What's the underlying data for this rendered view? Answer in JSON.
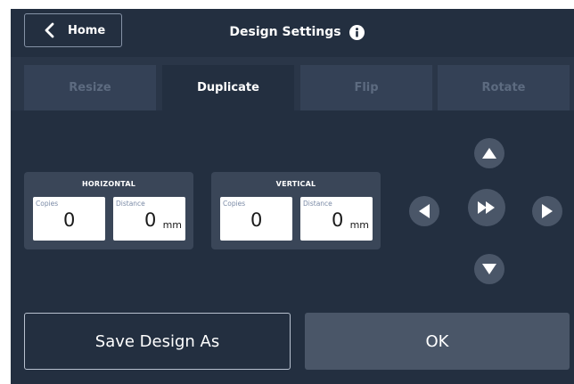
{
  "header": {
    "home_label": "Home",
    "title": "Design Settings",
    "back_icon": "chevron-left-icon",
    "info_icon": "info-icon"
  },
  "tabs": [
    {
      "label": "Resize",
      "active": false
    },
    {
      "label": "Duplicate",
      "active": true
    },
    {
      "label": "Flip",
      "active": false
    },
    {
      "label": "Rotate",
      "active": false
    }
  ],
  "horizontal": {
    "title": "HORIZONTAL",
    "copies_label": "Copies",
    "copies_value": "0",
    "distance_label": "Distance",
    "distance_value": "0",
    "distance_unit": "mm"
  },
  "vertical": {
    "title": "VERTICAL",
    "copies_label": "Copies",
    "copies_value": "0",
    "distance_label": "Distance",
    "distance_value": "0",
    "distance_unit": "mm"
  },
  "arrows": {
    "up_icon": "triangle-up-icon",
    "down_icon": "triangle-down-icon",
    "left_icon": "triangle-left-icon",
    "right_icon": "triangle-right-icon",
    "center_icon": "fast-forward-icon"
  },
  "footer": {
    "save_label": "Save Design As",
    "ok_label": "OK"
  },
  "colors": {
    "background": "#232f40",
    "tabbar": "#2a3648",
    "tab_inactive": "#344156",
    "panel": "#3a4658",
    "button": "#4a5668",
    "text": "#ffffff"
  }
}
